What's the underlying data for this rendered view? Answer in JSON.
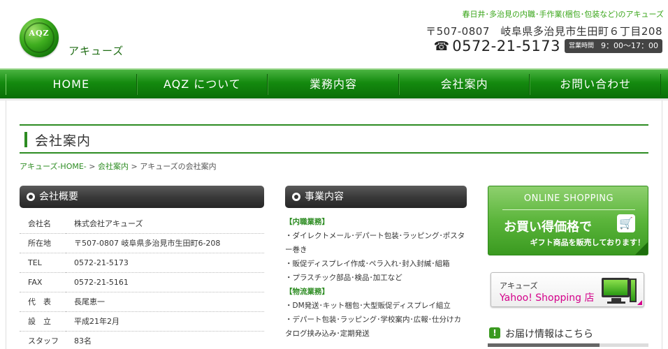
{
  "header": {
    "logo_mark": "AQZ",
    "logo_name": "アキューズ",
    "tagline": "春日井･多治見の内職･手作業(梱包･包装など)のアキューズ",
    "address": "〒507-0807　岐阜県多治見市生田町６丁目208",
    "tel_icon": "telephone-icon",
    "tel": "0572-21-5173",
    "hours_label": "営業時間",
    "hours": "9：00～17：00"
  },
  "nav": {
    "items": [
      "HOME",
      "AQZ について",
      "業務内容",
      "会社案内",
      "お問い合わせ"
    ]
  },
  "page": {
    "title": "会社案内",
    "breadcrumb": [
      {
        "label": "アキューズ-HOME-",
        "link": true
      },
      {
        "label": "会社案内",
        "link": true
      },
      {
        "label": "アキューズの会社案内",
        "link": false
      }
    ],
    "breadcrumb_sep": ">"
  },
  "company": {
    "heading": "会社概要",
    "rows": [
      {
        "k": "会社名",
        "v": "株式会社アキューズ"
      },
      {
        "k": "所在地",
        "v": "〒507-0807 岐阜県多治見市生田町6-208"
      },
      {
        "k": "TEL",
        "v": "0572-21-5173"
      },
      {
        "k": "FAX",
        "v": "0572-21-5161"
      },
      {
        "k": "代　表",
        "v": "長尾恵一"
      },
      {
        "k": "設　立",
        "v": "平成21年2月"
      },
      {
        "k": "スタッフ",
        "v": "83名"
      }
    ]
  },
  "business": {
    "heading": "事業内容",
    "lines": [
      {
        "text": "【内職業務】",
        "cat": true
      },
      {
        "text": "・ダイレクトメール･デパート包装･ラッピング･ポスター巻き",
        "cat": false
      },
      {
        "text": "・販促ディスプレイ作成･ペラ入れ･封入封緘･組箱",
        "cat": false
      },
      {
        "text": "・プラスチック部品･検品･加工など",
        "cat": false
      },
      {
        "text": "【物流業務】",
        "cat": true
      },
      {
        "text": "・DM発送･キット梱包･大型販促ディスプレイ組立",
        "cat": false
      },
      {
        "text": "・デパート包装･ラッピング･学校案内･広報･仕分けカタログ挟み込み･定期発送",
        "cat": false
      }
    ]
  },
  "sidebar": {
    "online": {
      "head": "ONLINE SHOPPING",
      "main": "お買い得価格で",
      "sub": "ギフト商品を販売しております！",
      "cart_icon": "cart-icon"
    },
    "yahoo": {
      "small": "アキューズ",
      "big": "Yahoo! Shopping 店",
      "icon": "computer-icon"
    },
    "delivery": {
      "icon": "!",
      "label": "お届け情報はこちら"
    }
  }
}
